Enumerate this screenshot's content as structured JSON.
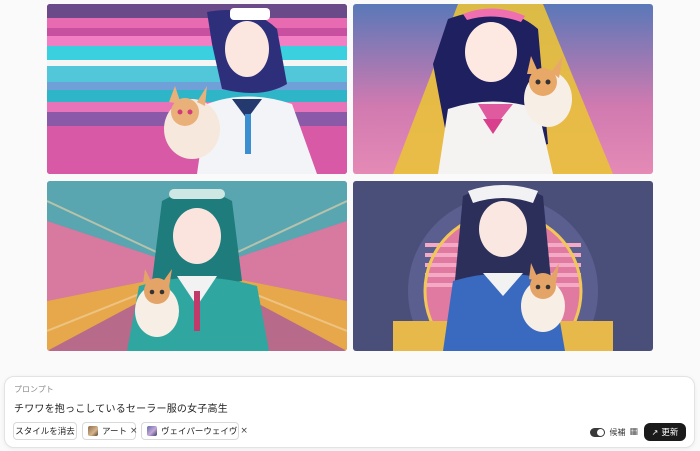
{
  "images": [
    {
      "name": "generated-image-1",
      "alt": ""
    },
    {
      "name": "generated-image-2",
      "alt": ""
    },
    {
      "name": "generated-image-3",
      "alt": ""
    },
    {
      "name": "generated-image-4",
      "alt": ""
    }
  ],
  "prompt": {
    "label": "プロンプト",
    "text": "チワワを抱っこしているセーラー服の女子高生"
  },
  "chips": {
    "clear_label": "スタイルを消去",
    "art_label": "アート",
    "vapor_label": "ヴェイパーウェイヴ",
    "remove_symbol": "×"
  },
  "controls": {
    "candidates_label": "候補",
    "update_label": "更新",
    "candidates_toggle_on": true
  },
  "icons": {
    "toggle": "toggle-switch-icon",
    "candidates_view": "image-grid-icon",
    "update": "open-external-icon"
  }
}
